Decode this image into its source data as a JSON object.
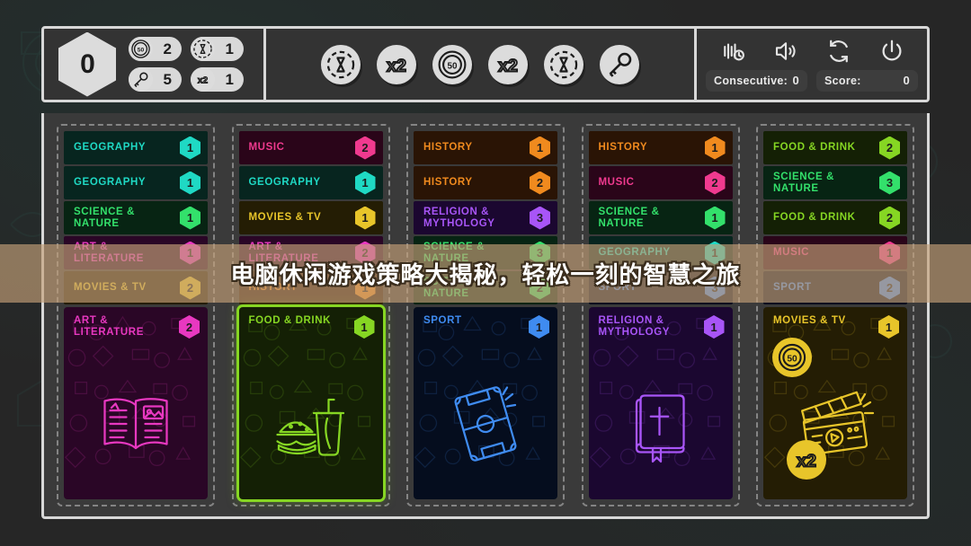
{
  "topbar": {
    "score_hex": "0",
    "inventory": [
      {
        "icon": "coin-50-icon",
        "count": "2"
      },
      {
        "icon": "hourglass-token-icon",
        "count": "1"
      },
      {
        "icon": "key-token-icon",
        "count": "5"
      },
      {
        "icon": "multiplier-x2-icon",
        "count": "1"
      }
    ],
    "powerups": [
      {
        "icon": "hourglass-token-icon"
      },
      {
        "icon": "multiplier-x2-icon"
      },
      {
        "icon": "coin-50-icon"
      },
      {
        "icon": "multiplier-x2-icon"
      },
      {
        "icon": "hourglass-token-icon"
      },
      {
        "icon": "key-token-icon"
      }
    ],
    "icons": [
      {
        "name": "vibration-icon"
      },
      {
        "name": "sound-icon"
      },
      {
        "name": "restart-icon"
      },
      {
        "name": "power-icon"
      }
    ],
    "stats": [
      {
        "label": "Consecutive:",
        "value": "0"
      },
      {
        "label": "Score:",
        "value": "0"
      }
    ]
  },
  "overlay": {
    "headline": "电脑休闲游戏策略大揭秘，轻松一刻的智慧之旅"
  },
  "board": {
    "columns": [
      {
        "id": "column-1",
        "rows": [
          {
            "label": "GEOGRAPHY",
            "value": "1",
            "color": "#1fd9c4",
            "bg": "#07251f"
          },
          {
            "label": "GEOGRAPHY",
            "value": "1",
            "color": "#1fd9c4",
            "bg": "#07251f"
          },
          {
            "label": "SCIENCE & NATURE",
            "value": "1",
            "color": "#33e06b",
            "bg": "#072413"
          },
          {
            "label": "ART & LITERATURE",
            "value": "1",
            "color": "#e838c0",
            "bg": "#2a0626"
          },
          {
            "label": "MOVIES & TV",
            "value": "2",
            "color": "#e8c52a",
            "bg": "#241d04"
          }
        ],
        "card": {
          "title": "ART & LITERATURE",
          "value": "2",
          "color": "#e838c0",
          "bg": "#2a0626",
          "art": "open-book-icon",
          "selected": false
        }
      },
      {
        "id": "column-2",
        "rows": [
          {
            "label": "MUSIC",
            "value": "2",
            "color": "#f03a8f",
            "bg": "#2a0519"
          },
          {
            "label": "GEOGRAPHY",
            "value": "1",
            "color": "#1fd9c4",
            "bg": "#07251f"
          },
          {
            "label": "MOVIES & TV",
            "value": "1",
            "color": "#e8c52a",
            "bg": "#241d04"
          },
          {
            "label": "ART & LITERATURE",
            "value": "2",
            "color": "#e838c0",
            "bg": "#2a0626"
          },
          {
            "label": "HISTORY",
            "value": "1",
            "color": "#f08a1e",
            "bg": "#2a1405"
          }
        ],
        "card": {
          "title": "FOOD & DRINK",
          "value": "1",
          "color": "#86d623",
          "bg": "#142005",
          "art": "burger-drink-icon",
          "selected": true
        }
      },
      {
        "id": "column-3",
        "rows": [
          {
            "label": "HISTORY",
            "value": "1",
            "color": "#f08a1e",
            "bg": "#2a1405"
          },
          {
            "label": "HISTORY",
            "value": "2",
            "color": "#f08a1e",
            "bg": "#2a1405"
          },
          {
            "label": "RELIGION &\nMYTHOLOGY",
            "value": "3",
            "color": "#a855f7",
            "bg": "#1b0730"
          },
          {
            "label": "SCIENCE & NATURE",
            "value": "3",
            "color": "#33e06b",
            "bg": "#072413"
          },
          {
            "label": "SCIENCE & NATURE",
            "value": "2",
            "color": "#33e06b",
            "bg": "#072413"
          }
        ],
        "card": {
          "title": "SPORT",
          "value": "1",
          "color": "#3f8bf0",
          "bg": "#050d1e",
          "art": "football-pitch-icon",
          "selected": false
        }
      },
      {
        "id": "column-4",
        "rows": [
          {
            "label": "HISTORY",
            "value": "1",
            "color": "#f08a1e",
            "bg": "#2a1405"
          },
          {
            "label": "MUSIC",
            "value": "2",
            "color": "#f03a8f",
            "bg": "#2a0519"
          },
          {
            "label": "SCIENCE & NATURE",
            "value": "1",
            "color": "#33e06b",
            "bg": "#072413"
          },
          {
            "label": "GEOGRAPHY",
            "value": "1",
            "color": "#1fd9c4",
            "bg": "#07251f"
          },
          {
            "label": "SPORT",
            "value": "3",
            "color": "#3f8bf0",
            "bg": "#050d1e"
          }
        ],
        "card": {
          "title": "RELIGION &\nMYTHOLOGY",
          "value": "1",
          "color": "#a855f7",
          "bg": "#1b0730",
          "art": "bible-icon",
          "selected": false
        }
      },
      {
        "id": "column-5",
        "rows": [
          {
            "label": "FOOD & DRINK",
            "value": "2",
            "color": "#86d623",
            "bg": "#142005"
          },
          {
            "label": "SCIENCE & NATURE",
            "value": "3",
            "color": "#33e06b",
            "bg": "#072413"
          },
          {
            "label": "FOOD & DRINK",
            "value": "2",
            "color": "#86d623",
            "bg": "#142005"
          },
          {
            "label": "MUSIC",
            "value": "1",
            "color": "#f03a8f",
            "bg": "#2a0519"
          },
          {
            "label": "SPORT",
            "value": "2",
            "color": "#3f8bf0",
            "bg": "#050d1e"
          }
        ],
        "card": {
          "title": "MOVIES & TV",
          "value": "1",
          "color": "#e8c52a",
          "bg": "#241d04",
          "art": "clapperboard-icon",
          "selected": false,
          "tokens": [
            {
              "icon": "coin-50-icon",
              "label": "50"
            },
            {
              "icon": "multiplier-x2-icon",
              "label": "x2"
            }
          ]
        }
      }
    ]
  }
}
